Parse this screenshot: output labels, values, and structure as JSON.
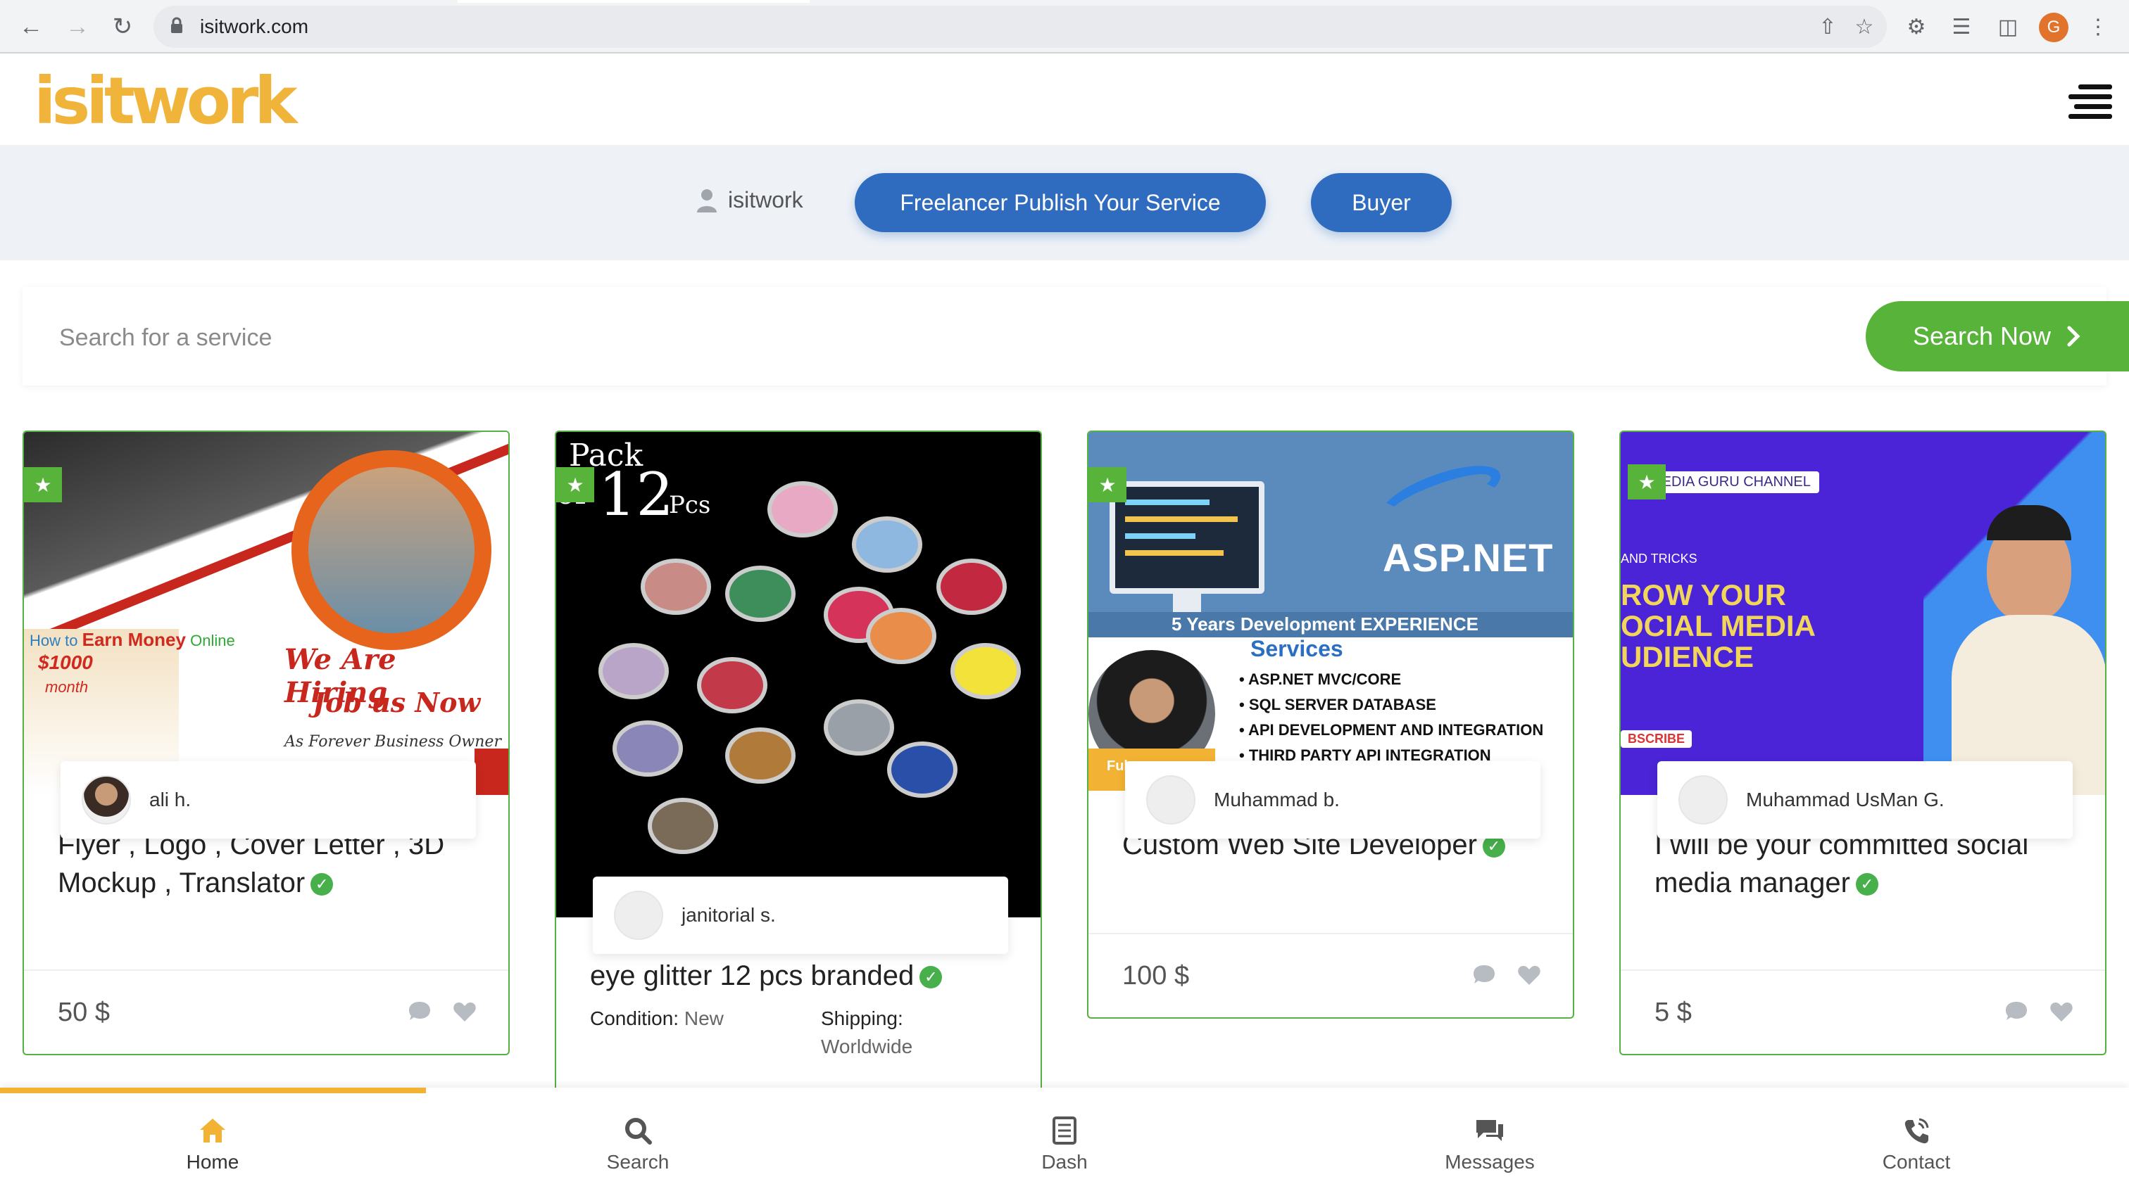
{
  "browser": {
    "url": "isitwork.com",
    "profile_initial": "G"
  },
  "site": {
    "logo_text": "isitwork"
  },
  "role_bar": {
    "username": "isitwork",
    "freelancer_button": "Freelancer Publish Your Service",
    "buyer_button": "Buyer"
  },
  "search": {
    "placeholder": "Search for a service",
    "button_label": "Search Now"
  },
  "cards": [
    {
      "seller": "ali h.",
      "title": "Flyer , Logo , Cover Letter , 3D Mockup , Translator",
      "price": "50 $",
      "art_text": {
        "earn_1": "How to",
        "earn_2": "Earn Money",
        "earn_3": "Online",
        "amount": "$1000",
        "period": "month",
        "hiring_1": "We Are Hiring",
        "hiring_2": "Job us Now",
        "hiring_3": "As Forever Business Owner"
      }
    },
    {
      "seller": "janitorial s.",
      "title": "eye glitter 12 pcs branded",
      "condition_label": "Condition:",
      "condition_value": "New",
      "shipping_label": "Shipping:",
      "shipping_value": "Worldwide",
      "art_text": {
        "pack_1": "Pack",
        "pack_2": "of",
        "pack_3": "12",
        "pack_4": "Pcs"
      }
    },
    {
      "seller": "Muhammad b.",
      "title": "Custom Web Site Developer",
      "price": "100 $",
      "art_text": {
        "brand": "ASP.NET",
        "experience": "5 Years Development EXPERIENCE",
        "services": "Services",
        "list": [
          "ASP.NET MVC/CORE",
          "SQL SERVER DATABASE",
          "API DEVELOPMENT AND INTEGRATION",
          "THIRD PARTY API INTEGRATION"
        ],
        "badge": "Ful"
      }
    },
    {
      "seller": "Muhammad UsMan G.",
      "title": "I will be your committed social media manager",
      "price": "5 $",
      "art_text": {
        "channel": "MEDIA GURU CHANNEL",
        "tricks": "AND TRICKS",
        "line1": "ROW YOUR",
        "line2": "OCIAL MEDIA",
        "line3": "UDIENCE",
        "subscribe": "BSCRIBE"
      }
    }
  ],
  "bottom_nav": {
    "items": [
      {
        "label": "Home",
        "icon": "home-icon"
      },
      {
        "label": "Search",
        "icon": "search-icon"
      },
      {
        "label": "Dash",
        "icon": "dashboard-icon"
      },
      {
        "label": "Messages",
        "icon": "messages-icon"
      },
      {
        "label": "Contact",
        "icon": "phone-icon"
      }
    ],
    "progress_fraction": 0.2
  },
  "colors": {
    "brand_yellow": "#f0b43a",
    "primary_blue": "#2f6cc0",
    "accent_green": "#57b33a"
  }
}
